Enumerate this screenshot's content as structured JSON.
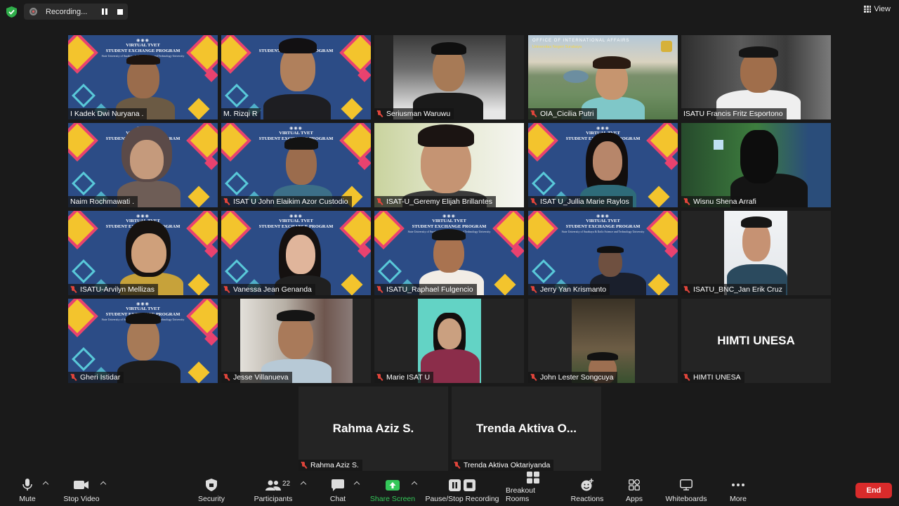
{
  "recording": {
    "label": "Recording..."
  },
  "view": {
    "label": "View"
  },
  "banner": {
    "line1": "VIRTUAL TVET",
    "line2": "STUDENT EXCHANGE PROGRAM",
    "line3": "State University of Surabaya & Iloilo Science and Technology University"
  },
  "oia_banner": {
    "line1": "OFFICE OF INTERNATIONAL AFFAIRS",
    "line2": "Universitas Negeri Surabaya"
  },
  "participants": [
    {
      "name": "I Kadek Dwi Nuryana .",
      "muted": false
    },
    {
      "name": "M. Rizqi R",
      "muted": false
    },
    {
      "name": "Seriusman Waruwu",
      "muted": true
    },
    {
      "name": "OIA_Cicilia Putri",
      "muted": true
    },
    {
      "name": "ISATU Francis Fritz Esportono",
      "muted": false
    },
    {
      "name": "Naim Rochmawati .",
      "muted": false
    },
    {
      "name": "ISAT U John Elaikim Azor Custodio",
      "muted": true
    },
    {
      "name": "ISAT-U_Geremy Elijah Brillantes",
      "muted": true
    },
    {
      "name": "ISAT U_Jullia Marie Raylos",
      "muted": true
    },
    {
      "name": "Wisnu Shena Arrafi",
      "muted": true
    },
    {
      "name": "ISATU-Arvilyn Mellizas",
      "muted": true
    },
    {
      "name": "Vanessa Jean Genanda",
      "muted": true
    },
    {
      "name": "ISATU_Raphael Fulgencio",
      "muted": true
    },
    {
      "name": "Jerry Yan Krismanto",
      "muted": true
    },
    {
      "name": "ISATU_BNC_Jan Erik Cruz",
      "muted": true
    },
    {
      "name": "Gheri Istidar",
      "muted": true
    },
    {
      "name": "Jesse Villanueva",
      "muted": true
    },
    {
      "name": "Marie ISAT U",
      "muted": true
    },
    {
      "name": "John Lester Songcuya",
      "muted": true
    },
    {
      "name": "HIMTI UNESA",
      "muted": true,
      "display": "HIMTI UNESA"
    },
    {
      "name": "Rahma Aziz S.",
      "muted": true,
      "display": "Rahma Aziz S."
    },
    {
      "name": "Trenda Aktiva Oktariyanda",
      "muted": true,
      "display": "Trenda Aktiva O..."
    }
  ],
  "toolbar": {
    "mute": "Mute",
    "stop_video": "Stop Video",
    "security": "Security",
    "participants": "Participants",
    "participants_count": "22",
    "chat": "Chat",
    "share_screen": "Share Screen",
    "pause_stop_recording": "Pause/Stop Recording",
    "breakout_rooms": "Breakout Rooms",
    "reactions": "Reactions",
    "apps": "Apps",
    "whiteboards": "Whiteboards",
    "more": "More",
    "end": "End"
  },
  "colors": {
    "active_speaker": "#bde138",
    "end_button": "#d92b2b",
    "share_screen": "#34c759",
    "muted_icon": "#e0453b"
  }
}
